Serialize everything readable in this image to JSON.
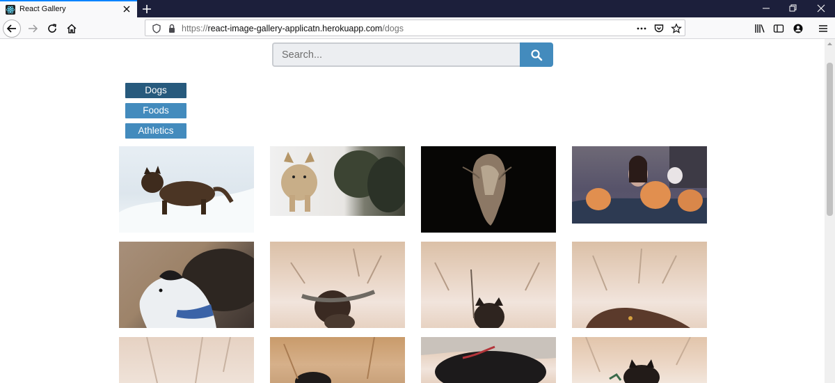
{
  "browser": {
    "tab_title": "React Gallery",
    "url_prefix": "https://",
    "url_host": "react-image-gallery-applicatn.herokuapp.com",
    "url_path": "/dogs"
  },
  "search": {
    "placeholder": "Search..."
  },
  "nav": {
    "items": [
      {
        "label": "Dogs",
        "active": true
      },
      {
        "label": "Foods",
        "active": false
      },
      {
        "label": "Athletics",
        "active": false
      }
    ]
  },
  "colors": {
    "accent": "#438bbd",
    "accent_active": "#275a7d",
    "tabbar": "#1c1f3b"
  }
}
